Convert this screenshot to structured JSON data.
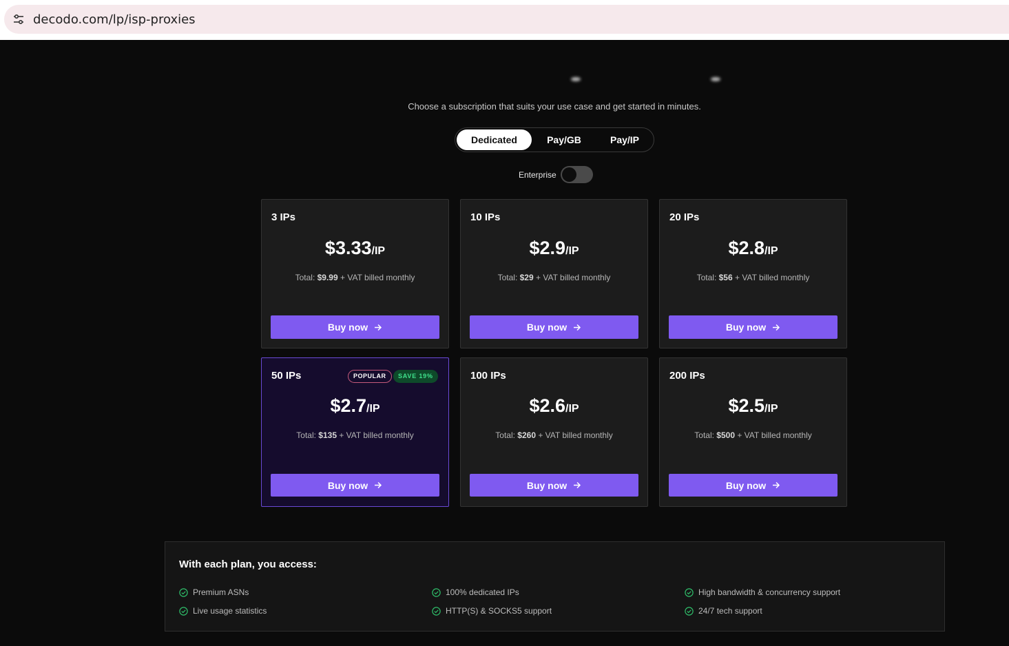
{
  "browser": {
    "url": "decodo.com/lp/isp-proxies"
  },
  "header": {
    "subtitle": "Choose a subscription that suits your use case and get started in minutes."
  },
  "tabs": [
    {
      "label": "Dedicated",
      "active": true
    },
    {
      "label": "Pay/GB",
      "active": false
    },
    {
      "label": "Pay/IP",
      "active": false
    }
  ],
  "enterprise": {
    "label": "Enterprise",
    "enabled": false
  },
  "plans": [
    {
      "title": "3 IPs",
      "price": "$3.33",
      "unit": "/IP",
      "total_prefix": "Total:",
      "total": "$9.99",
      "total_suffix": "+ VAT billed monthly",
      "button": "Buy now"
    },
    {
      "title": "10 IPs",
      "price": "$2.9",
      "unit": "/IP",
      "total_prefix": "Total:",
      "total": "$29",
      "total_suffix": "+ VAT billed monthly",
      "button": "Buy now"
    },
    {
      "title": "20 IPs",
      "price": "$2.8",
      "unit": "/IP",
      "total_prefix": "Total:",
      "total": "$56",
      "total_suffix": "+ VAT billed monthly",
      "button": "Buy now"
    },
    {
      "title": "50 IPs",
      "price": "$2.7",
      "unit": "/IP",
      "total_prefix": "Total:",
      "total": "$135",
      "total_suffix": "+ VAT billed monthly",
      "button": "Buy now",
      "badge_popular": "POPULAR",
      "badge_save": "SAVE 19%"
    },
    {
      "title": "100 IPs",
      "price": "$2.6",
      "unit": "/IP",
      "total_prefix": "Total:",
      "total": "$260",
      "total_suffix": "+ VAT billed monthly",
      "button": "Buy now"
    },
    {
      "title": "200 IPs",
      "price": "$2.5",
      "unit": "/IP",
      "total_prefix": "Total:",
      "total": "$500",
      "total_suffix": "+ VAT billed monthly",
      "button": "Buy now"
    }
  ],
  "access": {
    "title": "With each plan, you access:",
    "features": [
      "Premium ASNs",
      "100% dedicated IPs",
      "High bandwidth & concurrency support",
      "Live usage statistics",
      "HTTP(S) & SOCKS5 support",
      "24/7 tech support"
    ]
  },
  "colors": {
    "accent": "#7f5af0",
    "card": "#1c1c1c",
    "popular_card": "#150c2d",
    "check": "#2fbf6a"
  }
}
